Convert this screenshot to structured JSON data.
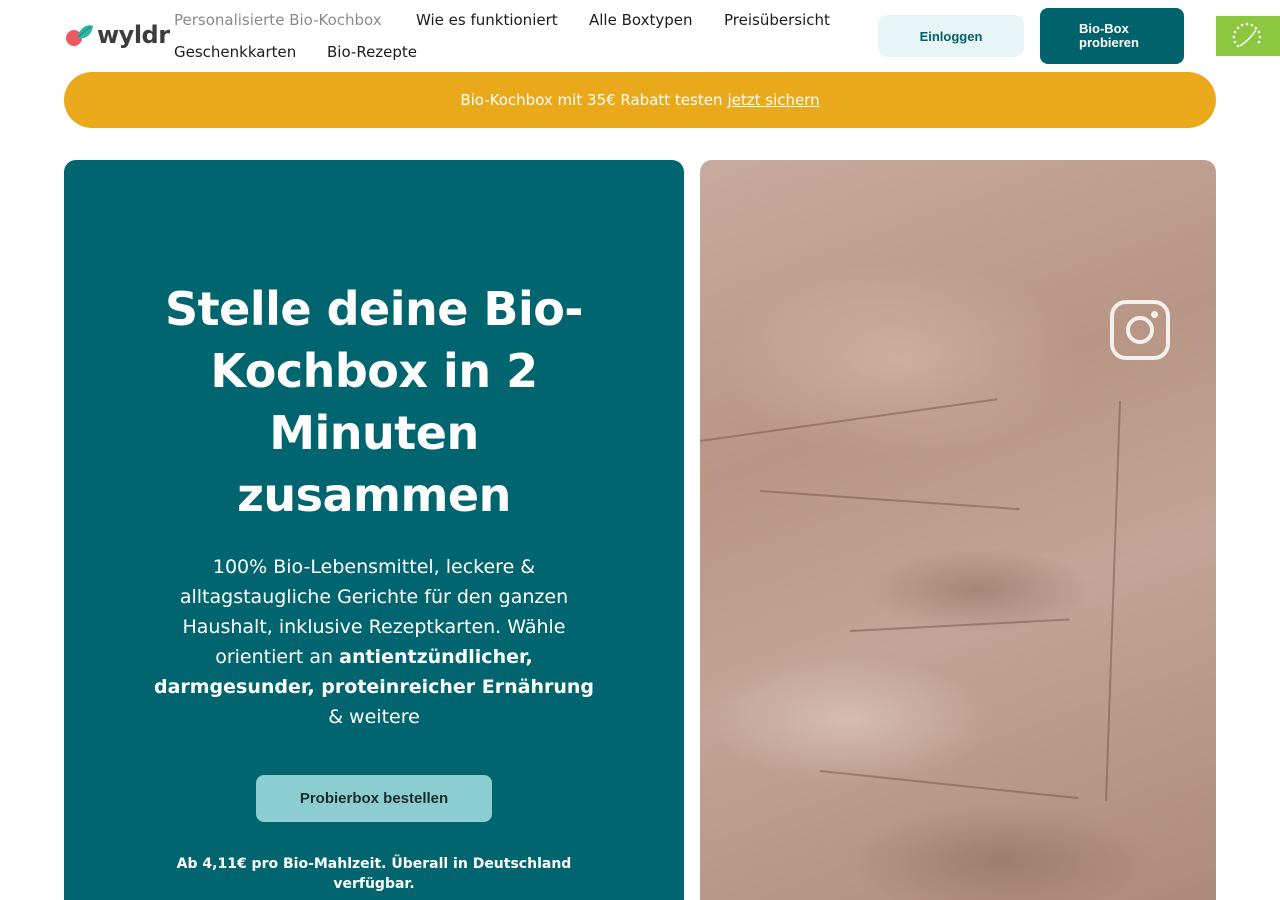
{
  "brand": {
    "name": "wyldr"
  },
  "nav": {
    "items": [
      {
        "label": "Personalisierte Bio-Kochbox"
      },
      {
        "label": "Wie es funktioniert"
      },
      {
        "label": "Alle Boxtypen"
      },
      {
        "label": "Preisübersicht"
      },
      {
        "label": "Geschenkkarten"
      },
      {
        "label": "Bio-Rezepte"
      }
    ]
  },
  "header": {
    "login_label": "Einloggen",
    "try_label": "Bio-Box probieren"
  },
  "banner": {
    "text": "Bio-Kochbox mit 35€ Rabatt testen",
    "link": "jetzt sichern"
  },
  "hero": {
    "title": "Stelle deine Bio-Kochbox in 2 Minuten zusammen",
    "text_part1": "100% Bio-Lebensmittel, leckere & alltagstaugliche Gerichte für den ganzen Haushalt, inklusive Rezeptkarten. Wähle orientiert an",
    "text_bold": "antientzündlicher, darmgesunder, proteinreicher Ernährung",
    "text_part2": "& weitere",
    "cta_label": "Probierbox bestellen",
    "footnote": "Ab 4,11€ pro Bio-Mahlzeit. Überall in Deutschland verfügbar."
  },
  "colors": {
    "primary": "#00656e",
    "banner": "#eaa91a",
    "cta_light": "#8ccdd1",
    "eu_organic": "#8dc63f"
  }
}
